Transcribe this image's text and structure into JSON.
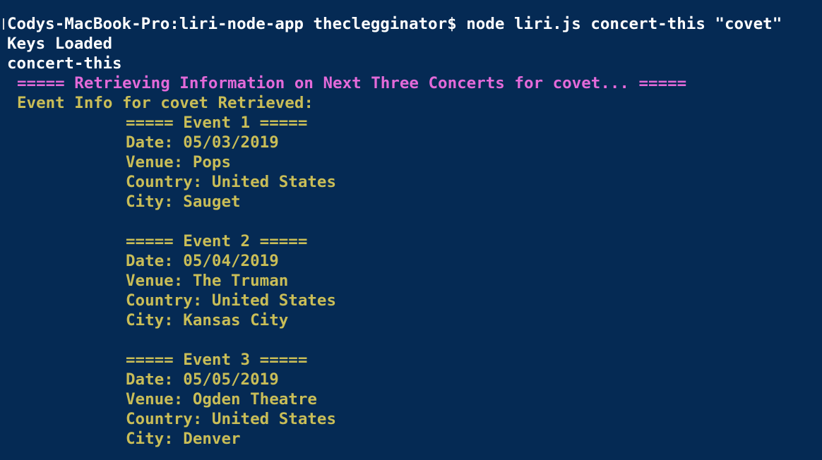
{
  "terminal": {
    "background": "#052a54",
    "prompt_line": "Codys-MacBook-Pro:liri-node-app theclegginator$ node liri.js concert-this \"covet\"",
    "output_lines": [
      "Keys Loaded",
      "concert-this"
    ],
    "retrieving": "===== Retrieving Information on Next Three Concerts for covet... =====",
    "retrieved": "Event Info for covet Retrieved:",
    "events": [
      {
        "header": "===== Event 1 =====",
        "date": "Date: 05/03/2019",
        "venue": "Venue: Pops",
        "country": "Country: United States",
        "city": "City: Sauget"
      },
      {
        "header": "===== Event 2 =====",
        "date": "Date: 05/04/2019",
        "venue": "Venue: The Truman",
        "country": "Country: United States",
        "city": "City: Kansas City"
      },
      {
        "header": "===== Event 3 =====",
        "date": "Date: 05/05/2019",
        "venue": "Venue: Ogden Theatre",
        "country": "Country: United States",
        "city": "City: Denver"
      }
    ]
  }
}
